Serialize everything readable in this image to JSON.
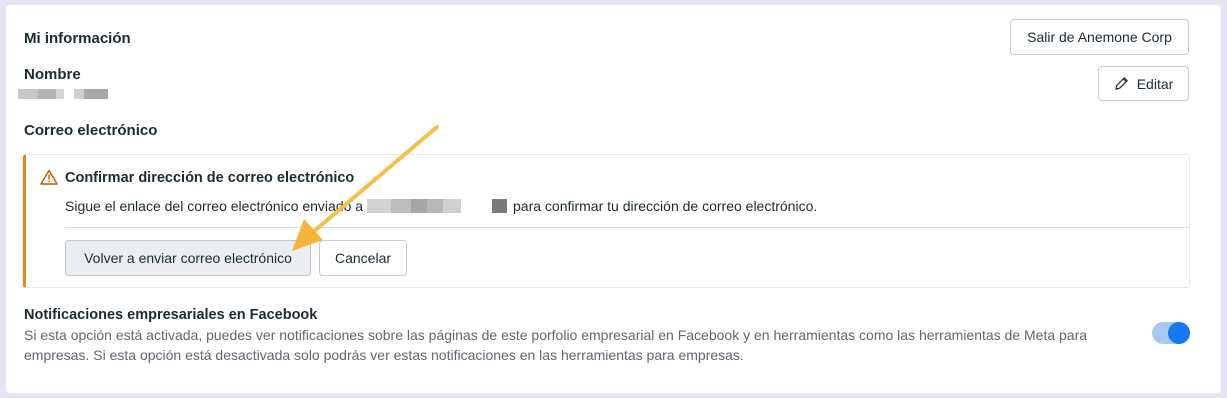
{
  "page": {
    "section_title": "Mi información",
    "leave_button": "Salir de Anemone Corp"
  },
  "name": {
    "label": "Nombre",
    "edit_button": "Editar"
  },
  "email": {
    "label": "Correo electrónico",
    "alert": {
      "title": "Confirmar dirección de correo electrónico",
      "text_before": "Sigue el enlace del correo electrónico enviado a",
      "text_after": "para confirmar tu dirección de correo electrónico.",
      "resend_button": "Volver a enviar correo electrónico",
      "cancel_button": "Cancelar"
    }
  },
  "notifications": {
    "title": "Notificaciones empresariales en Facebook",
    "description": "Si esta opción está activada, puedes ver notificaciones sobre las páginas de este porfolio empresarial en Facebook y en herramientas como las herramientas de Meta para empresas. Si esta opción está desactivada solo podrás ver estas notificaciones en las herramientas para empresas.",
    "toggle_on": true
  },
  "icons": {
    "edit": "pencil-icon",
    "warning": "warning-triangle-icon"
  },
  "colors": {
    "warning_accent": "#e5851a",
    "toggle_on": "#1877f2",
    "annotation_arrow": "#f5c04a"
  }
}
